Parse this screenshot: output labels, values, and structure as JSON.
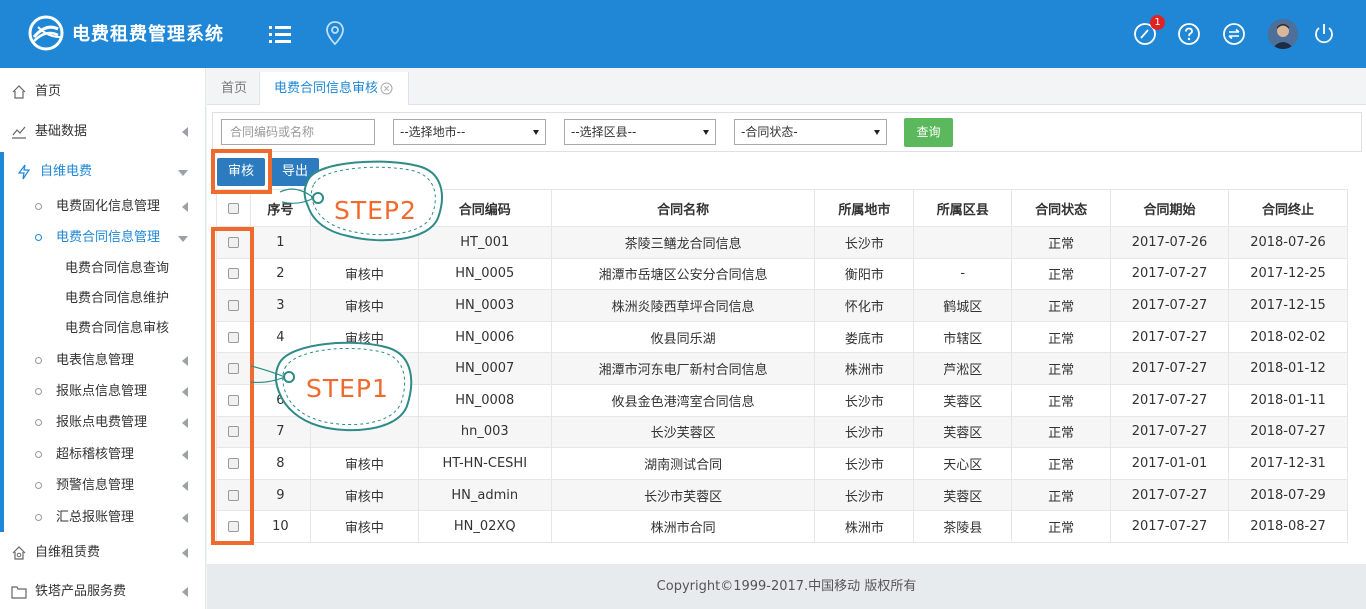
{
  "app": {
    "title": "电费租费管理系统",
    "notification_count": "1"
  },
  "colors": {
    "brand": "#1f87d6",
    "query": "#5cb85c",
    "highlight": "#f06a2e",
    "annotation": "#2e8b88"
  },
  "topbar_icons": [
    "menu-list-icon",
    "location-pin-icon",
    "edit-icon",
    "help-icon",
    "switch-icon",
    "avatar",
    "power-icon"
  ],
  "sidebar": {
    "home": "首页",
    "basic": "基础数据",
    "self_power": "自维电费",
    "fixed": "电费固化信息管理",
    "contract": "电费合同信息管理",
    "leaf_query": "电费合同信息查询",
    "leaf_maint": "电费合同信息维护",
    "leaf_audit": "电费合同信息审核",
    "meter": "电表信息管理",
    "point": "报账点信息管理",
    "point_fee": "报账点电费管理",
    "over": "超标稽核管理",
    "warn": "预警信息管理",
    "summary": "汇总报账管理",
    "rent": "自维租赁费",
    "tower": "铁塔产品服务费"
  },
  "tabs": {
    "home": "首页",
    "current": "电费合同信息审核"
  },
  "filter": {
    "code_placeholder": "合同编码或名称",
    "city": "--选择地市--",
    "district": "--选择区县--",
    "status": "-合同状态-",
    "query": "查询"
  },
  "actions": {
    "audit": "审核",
    "export": "导出"
  },
  "annotations": {
    "step1": "STEP1",
    "step2": "STEP2"
  },
  "table": {
    "headers": [
      "序号",
      "",
      "合同编码",
      "合同名称",
      "所属地市",
      "所属区县",
      "合同状态",
      "合同期始",
      "合同终止"
    ],
    "rows": [
      [
        "1",
        "",
        "HT_001",
        "茶陵三鳝龙合同信息",
        "长沙市",
        "",
        "正常",
        "2017-07-26",
        "2018-07-26"
      ],
      [
        "2",
        "审核中",
        "HN_0005",
        "湘潭市岳塘区公安分合同信息",
        "衡阳市",
        "-",
        "正常",
        "2017-07-27",
        "2017-12-25"
      ],
      [
        "3",
        "审核中",
        "HN_0003",
        "株洲炎陵西草坪合同信息",
        "怀化市",
        "鹤城区",
        "正常",
        "2017-07-27",
        "2017-12-15"
      ],
      [
        "4",
        "审核中",
        "HN_0006",
        "攸县同乐湖",
        "娄底市",
        "市辖区",
        "正常",
        "2017-07-27",
        "2018-02-02"
      ],
      [
        "",
        "",
        "HN_0007",
        "湘潭市河东电厂新村合同信息",
        "株洲市",
        "芦淞区",
        "正常",
        "2017-07-27",
        "2018-01-12"
      ],
      [
        "6",
        "",
        "HN_0008",
        "攸县金色港湾室合同信息",
        "长沙市",
        "芙蓉区",
        "正常",
        "2017-07-27",
        "2018-01-11"
      ],
      [
        "7",
        "",
        "hn_003",
        "长沙芙蓉区",
        "长沙市",
        "芙蓉区",
        "正常",
        "2017-07-27",
        "2018-07-27"
      ],
      [
        "8",
        "审核中",
        "HT-HN-CESHI",
        "湖南测试合同",
        "长沙市",
        "天心区",
        "正常",
        "2017-01-01",
        "2017-12-31"
      ],
      [
        "9",
        "审核中",
        "HN_admin",
        "长沙市芙蓉区",
        "长沙市",
        "芙蓉区",
        "正常",
        "2017-07-27",
        "2018-07-29"
      ],
      [
        "10",
        "审核中",
        "HN_02XQ",
        "株洲市合同",
        "株洲市",
        "茶陵县",
        "正常",
        "2017-07-27",
        "2018-08-27"
      ]
    ]
  },
  "footer": "Copyright©1999-2017.中国移动 版权所有"
}
